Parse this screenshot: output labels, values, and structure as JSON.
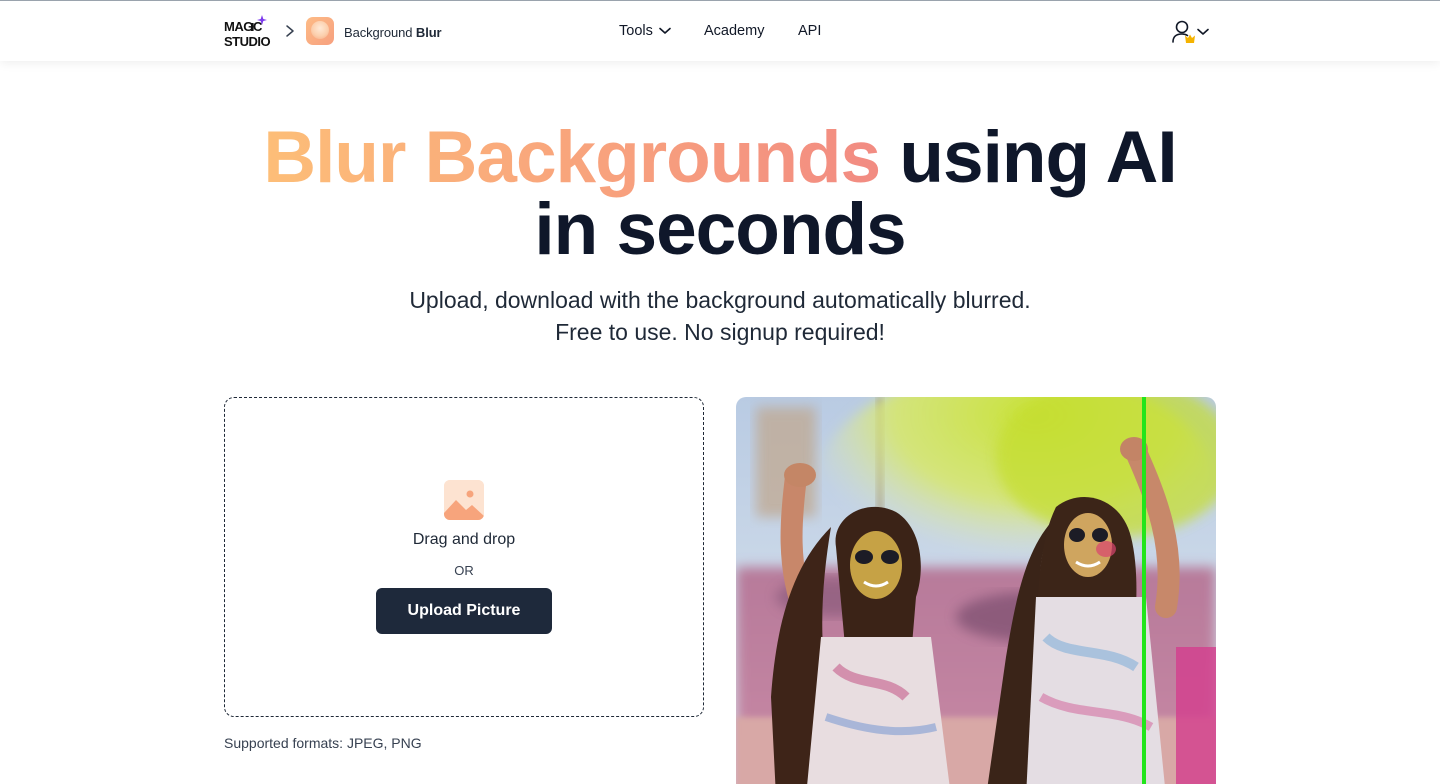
{
  "header": {
    "logo_text": "MAGIC STUDIO",
    "logo_icon": "sparkle-icon",
    "breadcrumb_separator_icon": "chevron-right-icon",
    "app_name_prefix": "Background",
    "app_name_bold": "Blur",
    "nav": {
      "tools": "Tools",
      "academy": "Academy",
      "api": "API"
    },
    "user_icon": "user-icon",
    "user_badge_icon": "crown-icon"
  },
  "hero": {
    "title_highlight": "Blur Backgrounds",
    "title_rest": " using AI",
    "title_line2": "in seconds",
    "subtitle_line1": "Upload, download with the background automatically blurred.",
    "subtitle_line2": "Free to use. No signup required!"
  },
  "upload": {
    "drag_text": "Drag and drop",
    "or_text": "OR",
    "button_label": "Upload Picture",
    "formats_text": "Supported formats: JPEG, PNG",
    "icon": "image-icon"
  },
  "preview": {
    "divider_color": "#22e51b"
  },
  "colors": {
    "accent_gradient_start": "#fdbe78",
    "accent_gradient_end": "#f28b82",
    "button_bg": "#1e293b",
    "title_dark": "#0f172a"
  }
}
